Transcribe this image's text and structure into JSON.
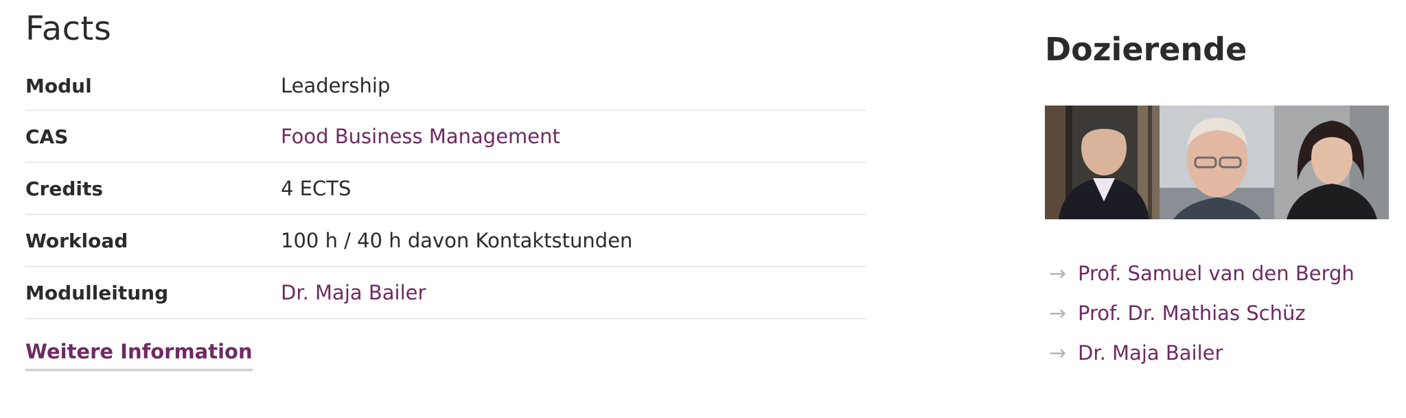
{
  "facts": {
    "title": "Facts",
    "rows": [
      {
        "label": "Modul",
        "value": "Leadership",
        "is_link": false
      },
      {
        "label": "CAS",
        "value": "Food Business Management",
        "is_link": true
      },
      {
        "label": "Credits",
        "value": "4 ECTS",
        "is_link": false
      },
      {
        "label": "Workload",
        "value": "100 h / 40 h davon Kontaktstunden",
        "is_link": false
      },
      {
        "label": "Modulleitung",
        "value": "Dr. Maja Bailer",
        "is_link": true
      }
    ],
    "more_info_label": "Weitere Information"
  },
  "lecturers": {
    "title": "Dozierende",
    "photos": [
      {
        "icon": "portrait-photo-man-dark-hair"
      },
      {
        "icon": "portrait-photo-man-glasses"
      },
      {
        "icon": "portrait-photo-woman-dark-hair"
      }
    ],
    "list": [
      {
        "icon": "arrow-right-icon",
        "name": "Prof. Samuel van den Bergh"
      },
      {
        "icon": "arrow-right-icon",
        "name": "Prof. Dr. Mathias Schüz"
      },
      {
        "icon": "arrow-right-icon",
        "name": "Dr. Maja Bailer"
      }
    ]
  },
  "colors": {
    "text": "#2b2b2b",
    "link": "#6e2a63",
    "divider": "#e8e8e8",
    "arrow": "#b5b5b5"
  }
}
